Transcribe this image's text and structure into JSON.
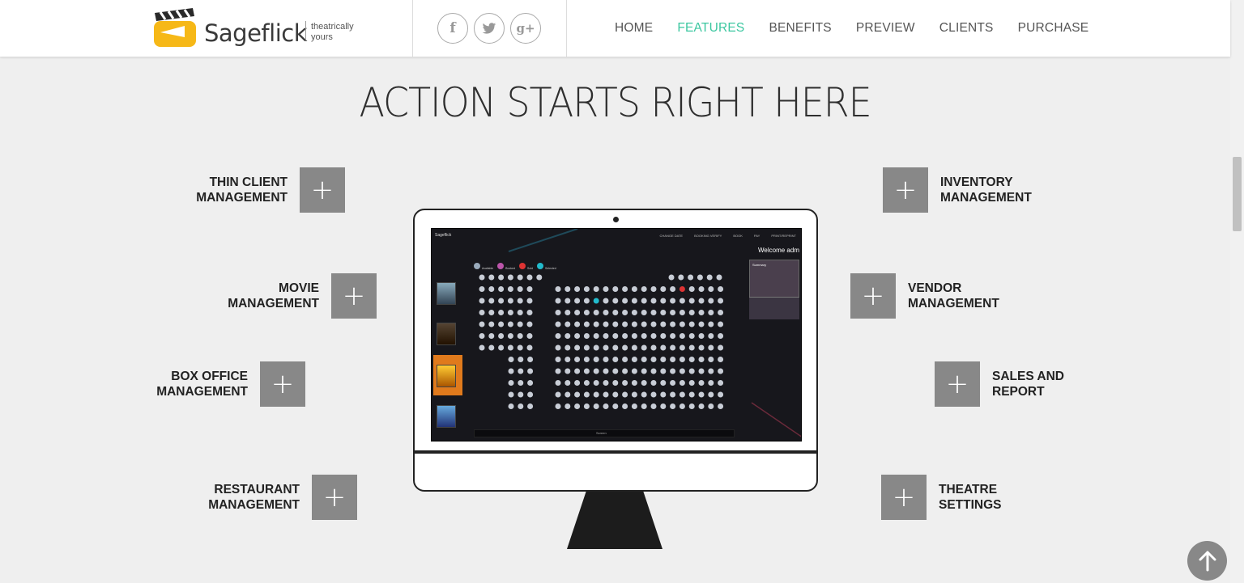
{
  "brand": {
    "name": "Sageflick",
    "tagline_line1": "theatrically",
    "tagline_line2": "yours"
  },
  "social": [
    {
      "name": "facebook-icon",
      "glyph": "f"
    },
    {
      "name": "twitter-icon",
      "glyph": "t"
    },
    {
      "name": "google-plus-icon",
      "glyph": "g+"
    }
  ],
  "nav": [
    "HOME",
    "FEATURES",
    "BENEFITS",
    "PREVIEW",
    "CLIENTS",
    "PURCHASE"
  ],
  "nav_active": "FEATURES",
  "accent_color": "#3cc7a0",
  "section": {
    "title": "ACTION STARTS RIGHT HERE"
  },
  "features": {
    "thin_client": {
      "line1": "THIN CLIENT",
      "line2": "MANAGEMENT"
    },
    "movie": {
      "line1": "MOVIE",
      "line2": "MANAGEMENT"
    },
    "box_office": {
      "line1": "BOX OFFICE",
      "line2": "MANAGEMENT"
    },
    "restaurant": {
      "line1": "RESTAURANT",
      "line2": "MANAGEMENT"
    },
    "inventory": {
      "line1": "INVENTORY",
      "line2": "MANAGEMENT"
    },
    "vendor": {
      "line1": "VENDOR",
      "line2": "MANAGEMENT"
    },
    "sales": {
      "line1": "SALES AND",
      "line2": "REPORT"
    },
    "theatre": {
      "line1": "THEATRE",
      "line2": "SETTINGS"
    }
  },
  "plus_glyph": "+",
  "screen": {
    "app_name": "Sageflick",
    "nav": [
      "CHANGE DATE",
      "BOOKING VERIFY",
      "BOOK",
      "PAY",
      "PRINT/REPRINT"
    ],
    "welcome": "Welcome adm",
    "legend": [
      "Available",
      "Booked",
      "Sold",
      "Selected"
    ],
    "summary_title": "Summary",
    "screen_label": "Screen"
  }
}
